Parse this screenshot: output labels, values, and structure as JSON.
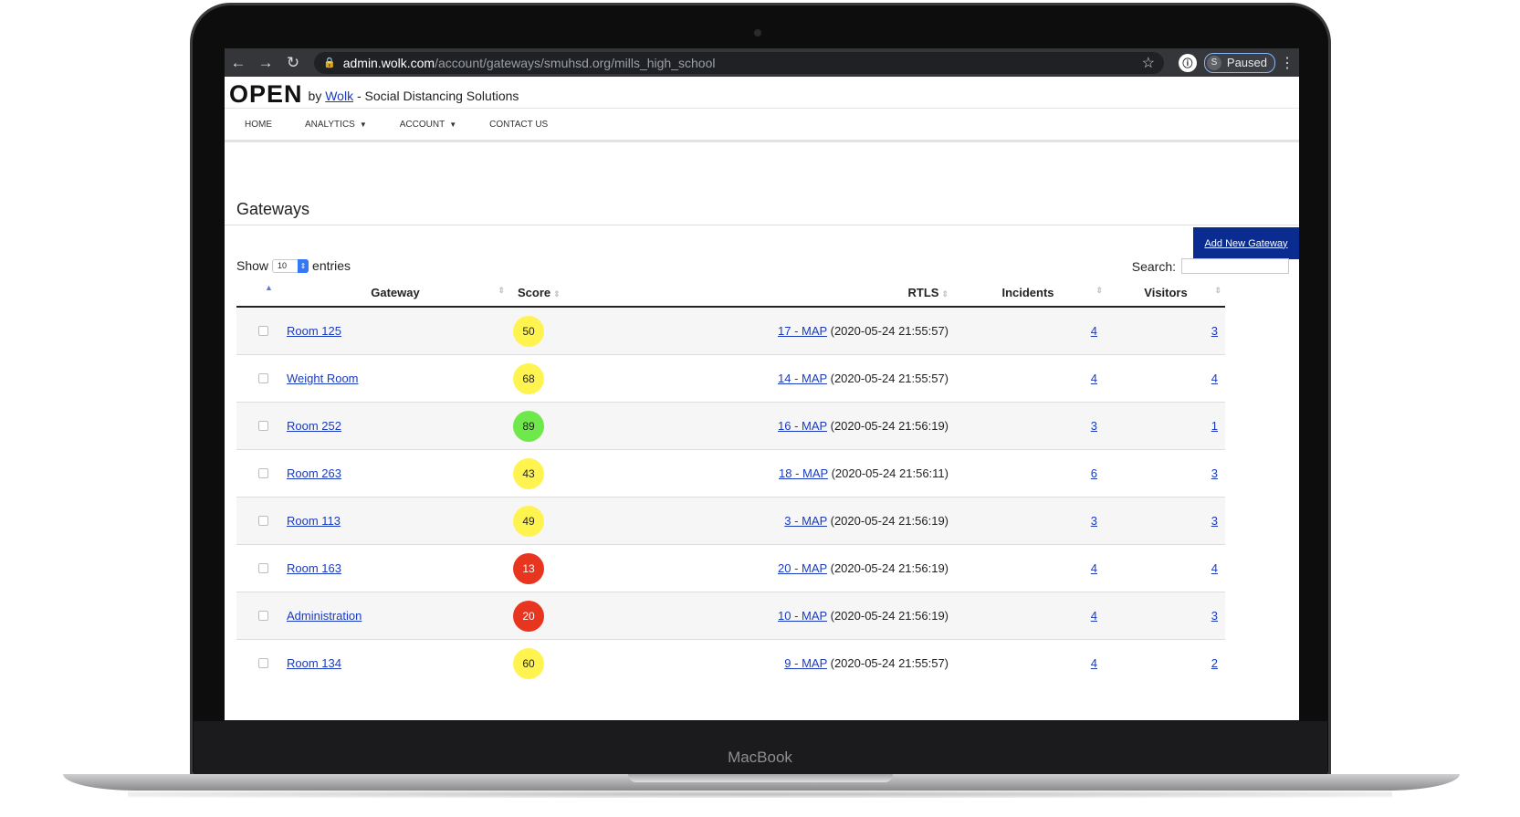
{
  "browser": {
    "url_host": "admin.wolk.com",
    "url_path": "/account/gateways/smuhsd.org/mills_high_school",
    "profile_initial": "S",
    "profile_status": "Paused"
  },
  "site": {
    "logo": "OPEN",
    "by": "by",
    "brand_link": "Wolk",
    "tagline": "- Social Distancing Solutions"
  },
  "menu": [
    {
      "label": "HOME"
    },
    {
      "label": "ANALYTICS"
    },
    {
      "label": "ACCOUNT"
    },
    {
      "label": "CONTACT US"
    }
  ],
  "page": {
    "title": "Gateways",
    "add_button": "Add New Gateway",
    "show_label": "Show",
    "entries_value": "10",
    "entries_label": "entries",
    "search_label": "Search:"
  },
  "table": {
    "headers": [
      "Gateway",
      "Score",
      "RTLS",
      "Incidents",
      "Visitors"
    ],
    "rows": [
      {
        "gateway": "Room 125",
        "score": "50",
        "score_color": "#fff44f",
        "rtls_link": "17 - MAP",
        "rtls_time": "(2020-05-24 21:55:57)",
        "incidents": "4",
        "visitors": "3"
      },
      {
        "gateway": "Weight Room",
        "score": "68",
        "score_color": "#fff44f",
        "rtls_link": "14 - MAP",
        "rtls_time": "(2020-05-24 21:55:57)",
        "incidents": "4",
        "visitors": "4"
      },
      {
        "gateway": "Room 252",
        "score": "89",
        "score_color": "#6ee84a",
        "rtls_link": "16 - MAP",
        "rtls_time": "(2020-05-24 21:56:19)",
        "incidents": "3",
        "visitors": "1"
      },
      {
        "gateway": "Room 263",
        "score": "43",
        "score_color": "#fff44f",
        "rtls_link": "18 - MAP",
        "rtls_time": "(2020-05-24 21:56:11)",
        "incidents": "6",
        "visitors": "3"
      },
      {
        "gateway": "Room 113",
        "score": "49",
        "score_color": "#fff44f",
        "rtls_link": "3 - MAP",
        "rtls_time": "(2020-05-24 21:56:19)",
        "incidents": "3",
        "visitors": "3"
      },
      {
        "gateway": "Room 163",
        "score": "13",
        "score_color": "#e8351f",
        "rtls_link": "20 - MAP",
        "rtls_time": "(2020-05-24 21:56:19)",
        "incidents": "4",
        "visitors": "4"
      },
      {
        "gateway": "Administration",
        "score": "20",
        "score_color": "#e8351f",
        "rtls_link": "10 - MAP",
        "rtls_time": "(2020-05-24 21:56:19)",
        "incidents": "4",
        "visitors": "3"
      },
      {
        "gateway": "Room 134",
        "score": "60",
        "score_color": "#fff44f",
        "rtls_link": "9 - MAP",
        "rtls_time": "(2020-05-24 21:55:57)",
        "incidents": "4",
        "visitors": "2"
      }
    ]
  },
  "device": {
    "brand": "MacBook"
  }
}
